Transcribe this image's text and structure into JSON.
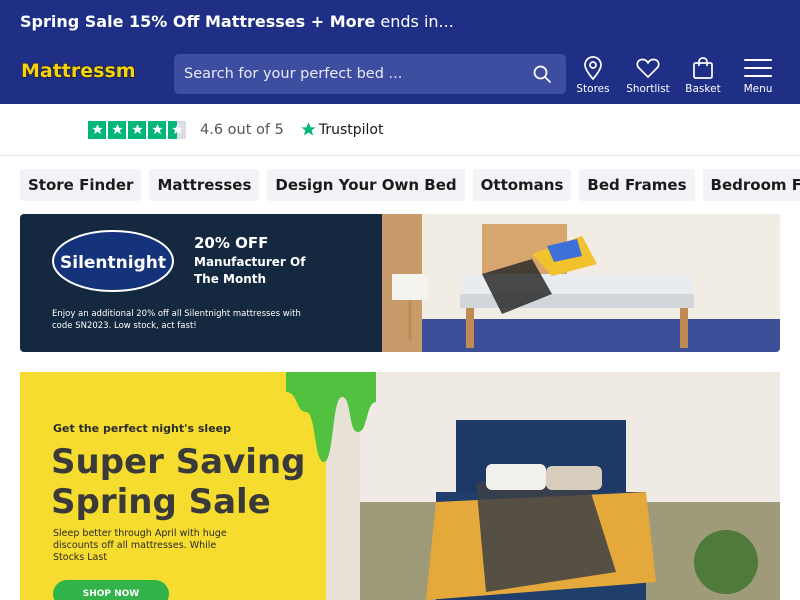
{
  "promo": {
    "bold_text": "Spring Sale 15% Off Mattresses + More",
    "tail_text": "ends in..."
  },
  "header": {
    "logo_text": "Mattressman",
    "search_placeholder": "Search for your perfect bed ...",
    "nav": [
      {
        "label": "Stores",
        "icon": "location-pin-icon"
      },
      {
        "label": "Shortlist",
        "icon": "heart-icon"
      },
      {
        "label": "Basket",
        "icon": "shopping-bag-icon"
      },
      {
        "label": "Menu",
        "icon": "hamburger-menu-icon"
      }
    ]
  },
  "trustbar": {
    "rating_text": "4.6 out of 5",
    "brand": "Trustpilot",
    "stars": 4.5
  },
  "categories": [
    "Store Finder",
    "Mattresses",
    "Design Your Own Bed",
    "Ottomans",
    "Bed Frames",
    "Bedroom Furniture"
  ],
  "banner_silentnight": {
    "logo_text": "Silentnight",
    "title": "20% OFF",
    "subtitle": "Manufacturer Of The Month",
    "fine_print": "Enjoy an additional 20% off all Silentnight mattresses with code SN2023. Low stock, act fast!"
  },
  "banner_spring": {
    "kicker": "Get the perfect night's sleep",
    "title": "Super Saving Spring Sale",
    "body": "Sleep better through April with huge discounts off all mattresses. While Stocks Last",
    "button": "SHOP NOW"
  },
  "colors": {
    "brand_navy": "#1f2f86",
    "trustpilot_green": "#00b67a",
    "sale_yellow": "#f6dc2f",
    "cta_green": "#32b34a"
  }
}
